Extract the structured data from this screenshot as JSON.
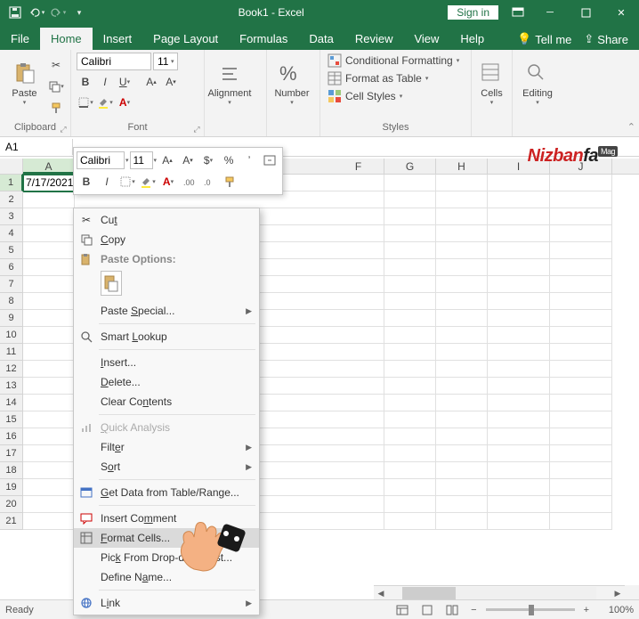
{
  "titlebar": {
    "title": "Book1 - Excel",
    "signin": "Sign in"
  },
  "tabs": {
    "items": [
      "File",
      "Home",
      "Insert",
      "Page Layout",
      "Formulas",
      "Data",
      "Review",
      "View",
      "Help"
    ],
    "active": "Home",
    "tellme": "Tell me",
    "share": "Share"
  },
  "ribbon": {
    "clipboard": {
      "label": "Clipboard",
      "paste": "Paste"
    },
    "font": {
      "label": "Font",
      "name": "Calibri",
      "size": "11"
    },
    "alignment": {
      "label": "Alignment"
    },
    "number": {
      "label": "Number",
      "symbol": "%"
    },
    "styles": {
      "label": "Styles",
      "conditional": "Conditional Formatting",
      "table": "Format as Table",
      "cell": "Cell Styles"
    },
    "cells": {
      "label": "Cells"
    },
    "editing": {
      "label": "Editing"
    }
  },
  "namebox": "A1",
  "mini": {
    "font": "Calibri",
    "size": "11"
  },
  "grid": {
    "columns": [
      "A",
      "F",
      "G",
      "H",
      "I",
      "J"
    ],
    "a1": "7/17/2021",
    "rowcount": 21
  },
  "context": {
    "cut": "Cut",
    "copy": "Copy",
    "paste_options": "Paste Options:",
    "paste_special": "Paste Special...",
    "smart_lookup": "Smart Lookup",
    "insert": "Insert...",
    "delete": "Delete...",
    "clear": "Clear Contents",
    "quick": "Quick Analysis",
    "filter": "Filter",
    "sort": "Sort",
    "getdata": "Get Data from Table/Range...",
    "comment": "Insert Comment",
    "format": "Format Cells...",
    "pick": "Pick From Drop-down List...",
    "define": "Define Name...",
    "link": "Link"
  },
  "watermark": {
    "p1": "Nizban",
    "p2": "fa",
    "tag": "Mag"
  },
  "status": {
    "ready": "Ready",
    "zoom": "100%"
  }
}
